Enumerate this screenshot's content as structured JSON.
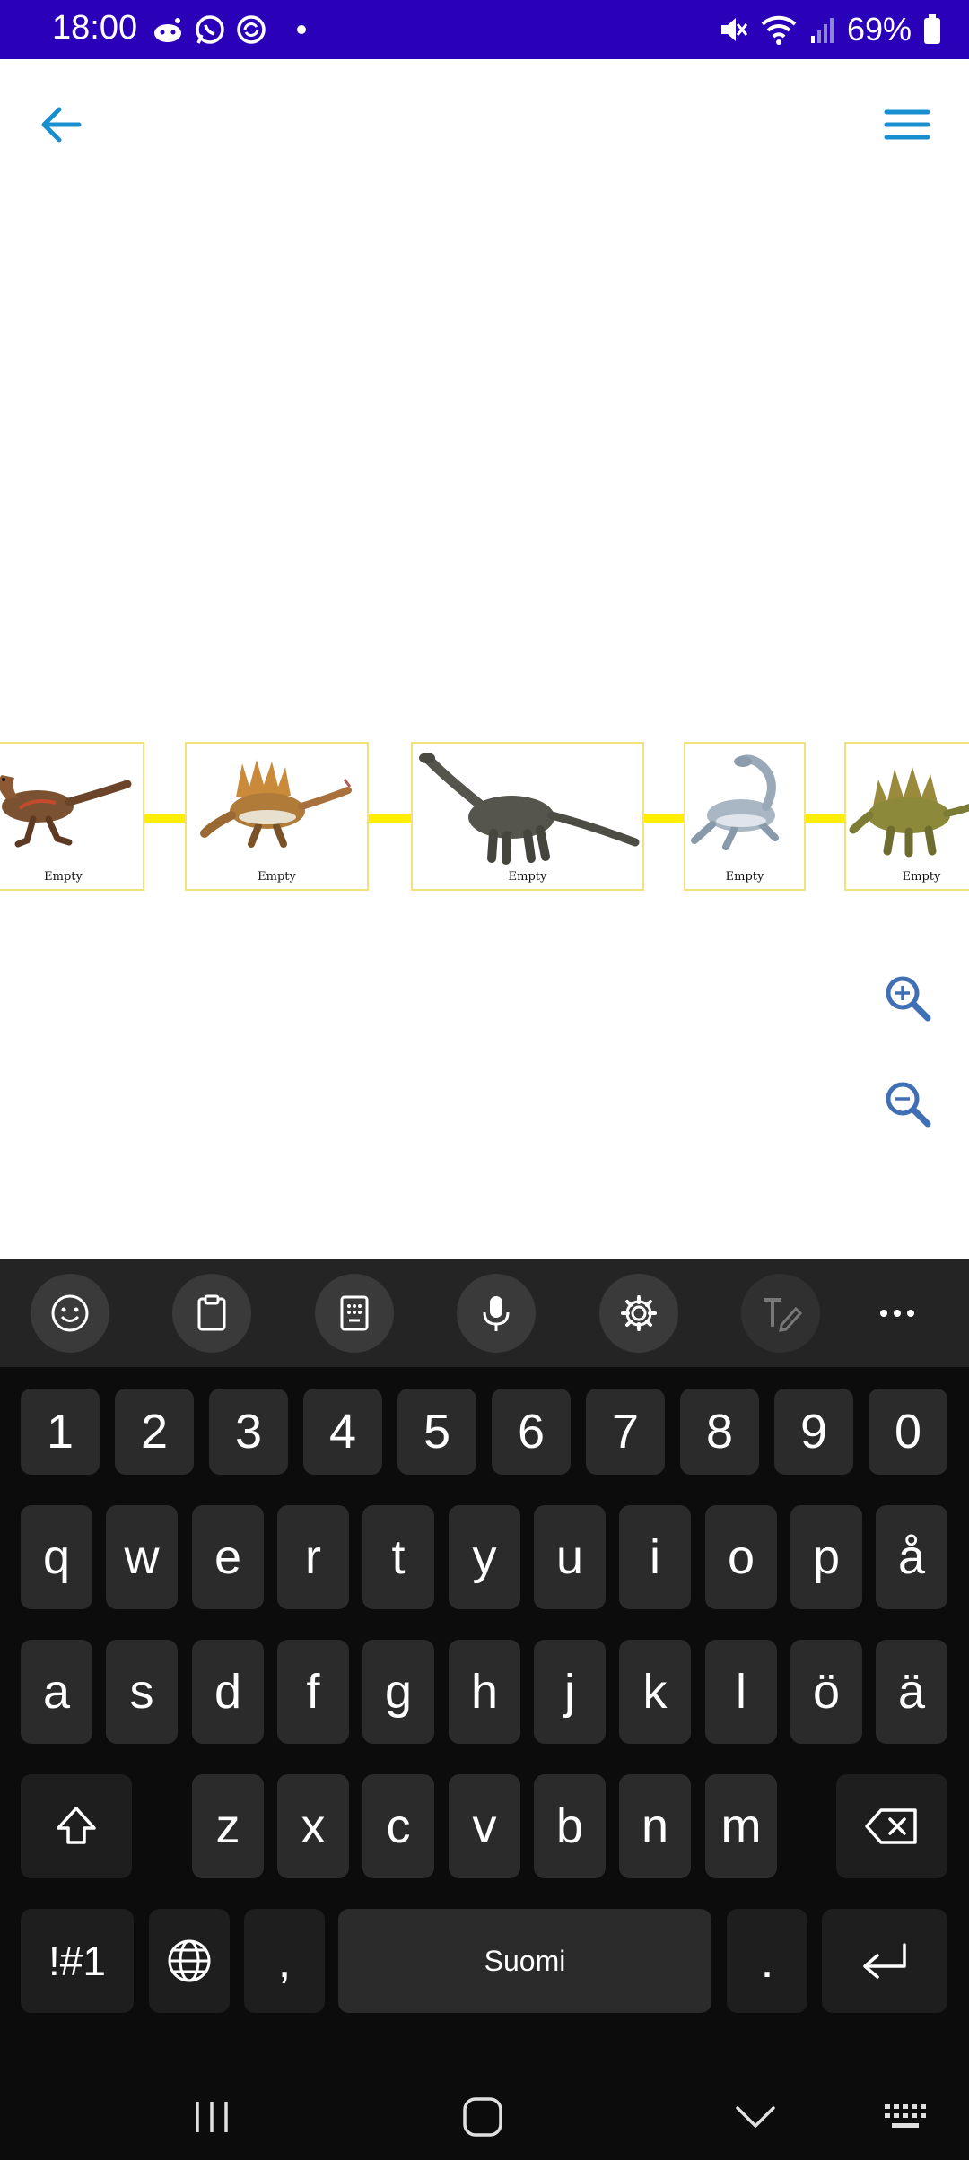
{
  "status_bar": {
    "time": "18:00",
    "battery_percent": "69%",
    "left_icons": [
      "reddit-icon",
      "whatsapp-icon",
      "sync-icon",
      "dot-icon"
    ],
    "right_icons": [
      "mute-icon",
      "wifi-icon",
      "signal-icon",
      "battery-icon"
    ]
  },
  "app_bar": {
    "back_icon": "arrow-left-icon",
    "menu_icon": "hamburger-menu-icon",
    "accent_color": "#1a8fcf"
  },
  "timeline": {
    "line_color": "#ffee00",
    "cards": [
      {
        "animal": "raptor",
        "label": "Empty"
      },
      {
        "animal": "spinosaurus",
        "label": "Empty"
      },
      {
        "animal": "sauropod",
        "label": "Empty"
      },
      {
        "animal": "plesiosaur",
        "label": "Empty"
      },
      {
        "animal": "stegosaurus",
        "label": "Empty"
      }
    ]
  },
  "zoom": {
    "zoom_in_icon": "zoom-in-icon",
    "zoom_out_icon": "zoom-out-icon",
    "color": "#3f6fb5"
  },
  "keyboard": {
    "toolbar": [
      "emoji-icon",
      "clipboard-icon",
      "keypad-icon",
      "microphone-icon",
      "settings-icon",
      "handwriting-icon",
      "more-icon"
    ],
    "number_row": [
      "1",
      "2",
      "3",
      "4",
      "5",
      "6",
      "7",
      "8",
      "9",
      "0"
    ],
    "row1": [
      "q",
      "w",
      "e",
      "r",
      "t",
      "y",
      "u",
      "i",
      "o",
      "p",
      "å"
    ],
    "row2": [
      "a",
      "s",
      "d",
      "f",
      "g",
      "h",
      "j",
      "k",
      "l",
      "ö",
      "ä"
    ],
    "row3": [
      "z",
      "x",
      "c",
      "v",
      "b",
      "n",
      "m"
    ],
    "symbols_key": "!#1",
    "comma_key": ",",
    "space_label": "Suomi",
    "period_key": "."
  },
  "nav_bar": {
    "icons": [
      "recent-apps-icon",
      "home-icon",
      "back-chevron-icon",
      "keyboard-hide-icon"
    ]
  }
}
